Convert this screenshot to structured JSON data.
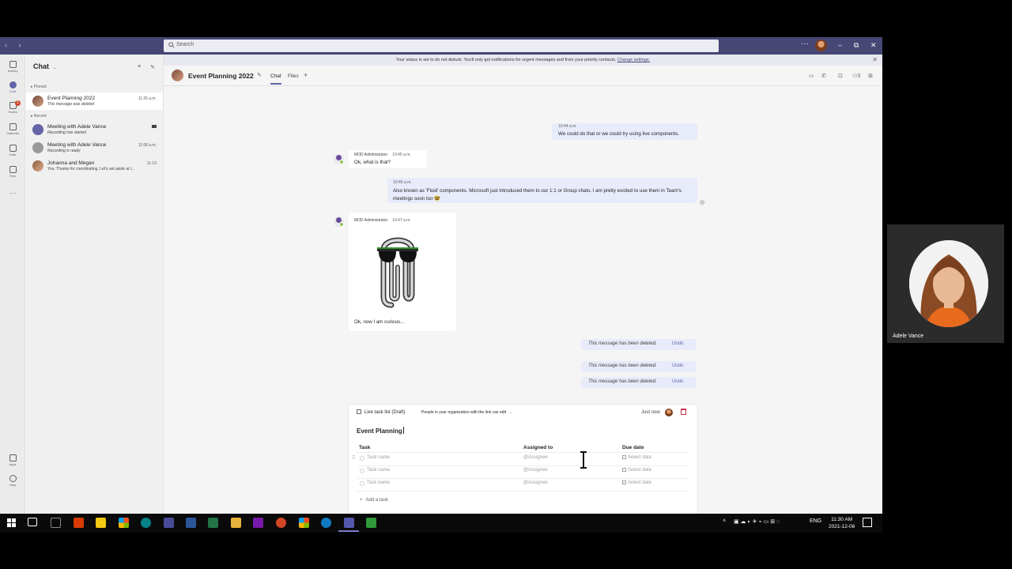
{
  "titlebar": {
    "search_placeholder": "Search",
    "more": "···",
    "minimize": "–",
    "maximize": "⧉",
    "close": "✕"
  },
  "banner": {
    "text": "Your status is set to do not disturb. You'll only get notifications for urgent messages and from your priority contacts.",
    "link": "Change settings."
  },
  "appbar": {
    "items": [
      {
        "label": "Activity",
        "icon": "bell-icon"
      },
      {
        "label": "Chat",
        "icon": "chat-icon"
      },
      {
        "label": "Teams",
        "icon": "teams-icon",
        "badge": "1"
      },
      {
        "label": "Calendar",
        "icon": "calendar-icon"
      },
      {
        "label": "Calls",
        "icon": "phone-icon"
      },
      {
        "label": "Files",
        "icon": "file-icon"
      }
    ],
    "bottom": [
      {
        "label": "Apps",
        "icon": "apps-icon"
      },
      {
        "label": "Help",
        "icon": "help-icon"
      }
    ]
  },
  "chatlist": {
    "title": "Chat",
    "pinned_label": "Pinned",
    "recent_label": "Recent",
    "items": [
      {
        "name": "Event Planning 2022",
        "sub": "This message was deleted",
        "time": "11:25 a.m."
      },
      {
        "name": "Meeting with Adele Vance",
        "sub": "Recording has started",
        "time": ""
      },
      {
        "name": "Meeting with Adele Vance",
        "sub": "Recording is ready",
        "time": "11:08 a.m."
      },
      {
        "name": "Johanna and Megan",
        "sub": "You: Thanks for coordinating. Let's set aside at l...",
        "time": "11-19"
      }
    ]
  },
  "chat": {
    "title": "Event Planning 2022",
    "tabs": [
      "Chat",
      "Files"
    ],
    "messages": {
      "m1_time": "10:44 a.m.",
      "m1_text": "We could do that or we could try using live components.",
      "m2_author": "MOD Administrator",
      "m2_time": "10:45 a.m.",
      "m2_text": "Ok, what is that?",
      "m3_time": "10:46 a.m.",
      "m3_text": "Also known as 'Fluid' components. Microsoft just introduced them to our 1:1 or Group chats. I am pretty excited to use them in Team's meetings soon too 🤓",
      "m4_author": "MOD Administrator",
      "m4_time": "10:47 a.m.",
      "m4_text": "Ok, now I am curious..."
    },
    "deleted_text": "This message has been deleted.",
    "undo_label": "Undo"
  },
  "loop": {
    "type_label": "Live task list (Draft)",
    "permission": "People in your organization with the link can edit",
    "permission_chevron": "⌄",
    "updated": "Just now",
    "title": "Event Planning",
    "columns": {
      "task": "Task",
      "assigned": "Assigned to",
      "due": "Due date"
    },
    "rows": [
      {
        "task": "Task name",
        "assignee": "@Assignee",
        "due": "Select date"
      },
      {
        "task": "Task name",
        "assignee": "@Assignee",
        "due": "Select date"
      },
      {
        "task": "Task name",
        "assignee": "@Assignee",
        "due": "Select date"
      }
    ],
    "add_task": "Add a task"
  },
  "video": {
    "name": "Adele Vance"
  },
  "taskbar": {
    "lang": "ENG",
    "time": "11:30 AM",
    "date": "2021-12-06"
  },
  "colors": {
    "teams_purple": "#464775",
    "accent": "#6264a7",
    "bubble_out": "#e8ebfa"
  }
}
